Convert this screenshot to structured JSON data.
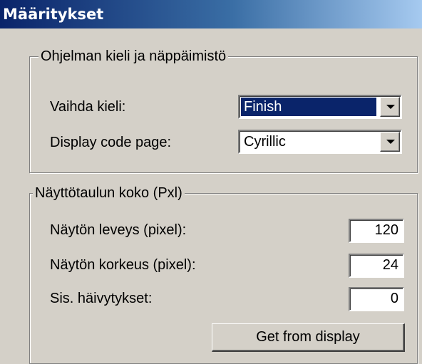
{
  "window": {
    "title": "Määritykset"
  },
  "language_group": {
    "legend": "Ohjelman kieli ja näppäimistö",
    "change_language_label": "Vaihda kieli:",
    "change_language_value": "Finish",
    "code_page_label": "Display code page:",
    "code_page_value": "Cyrillic"
  },
  "display_group": {
    "legend": "Näyttötaulun koko (Pxl)",
    "width_label": "Näytön leveys (pixel):",
    "width_value": "120",
    "height_label": "Näytön korkeus (pixel):",
    "height_value": "24",
    "fade_label": "Sis. häivytykset:",
    "fade_value": "0",
    "get_button": "Get from display"
  },
  "colors": {
    "title_start": "#0a246a",
    "title_end": "#a6caf0",
    "face": "#d4d0c8",
    "selection": "#0a246a"
  },
  "icons": {
    "dropdown": "chevron-down-icon"
  }
}
